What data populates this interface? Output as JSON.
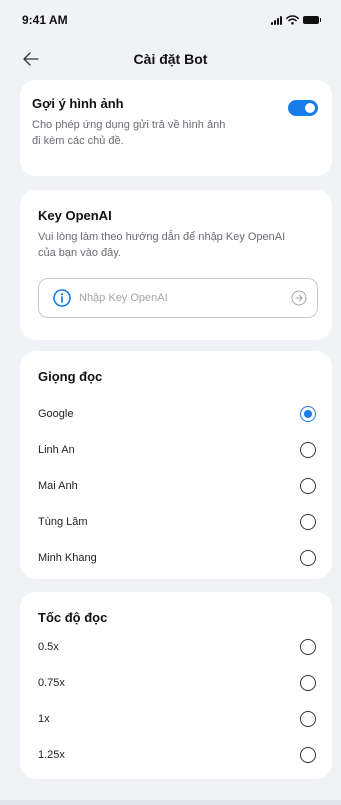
{
  "status_bar": {
    "time": "9:41 AM"
  },
  "header": {
    "title": "Cài đặt Bot"
  },
  "image_suggestion": {
    "title": "Gợi ý hình ảnh",
    "description_line1": "Cho phép ứng dụng gửi trả về hình ảnh",
    "description_line2": "đi kèm các chủ đề.",
    "enabled": true
  },
  "openai_key": {
    "title": "Key OpenAI",
    "description_line1": "Vui lòng làm theo hướng dẫn để nhập Key OpenAI",
    "description_line2": "của bạn vào đây.",
    "placeholder": "Nhập Key OpenAI",
    "value": ""
  },
  "voice": {
    "title": "Giọng đọc",
    "options": [
      {
        "label": "Google",
        "checked": true
      },
      {
        "label": "Linh An",
        "checked": false
      },
      {
        "label": "Mai Anh",
        "checked": false
      },
      {
        "label": "Tùng Lâm",
        "checked": false
      },
      {
        "label": "Minh Khang",
        "checked": false
      }
    ]
  },
  "speed": {
    "title": "Tốc độ đọc",
    "options": [
      {
        "label": "0.5x",
        "checked": false
      },
      {
        "label": "0.75x",
        "checked": false
      },
      {
        "label": "1x",
        "checked": false
      },
      {
        "label": "1.25x",
        "checked": false
      }
    ]
  },
  "colors": {
    "accent": "#1a7bea",
    "background": "#f1f2f6",
    "card": "#ffffff"
  }
}
